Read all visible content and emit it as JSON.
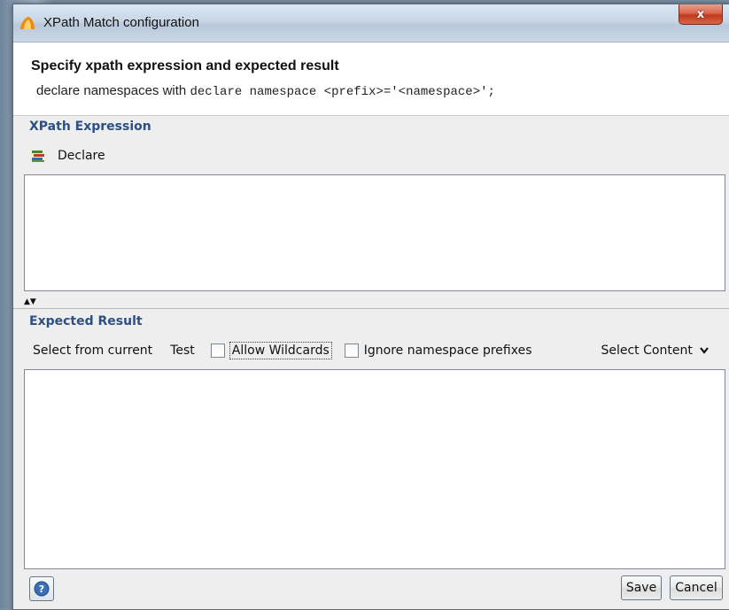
{
  "window": {
    "title": "XPath Match configuration",
    "close_label": "x"
  },
  "header": {
    "title": "Specify xpath expression and expected result",
    "desc_prefix": "declare namespaces with ",
    "desc_code": "declare namespace <prefix>='<namespace>';"
  },
  "xpath": {
    "section_label": "XPath Expression",
    "declare_label": "Declare",
    "value": ""
  },
  "splitter": {
    "up": "▲",
    "down": "▼"
  },
  "expected": {
    "section_label": "Expected Result",
    "select_from_current": "Select from current",
    "test": "Test",
    "allow_wildcards": "Allow Wildcards",
    "ignore_ns": "Ignore namespace prefixes",
    "select_content": "Select Content",
    "value": ""
  },
  "footer": {
    "help_label": "?",
    "save_label": "Save",
    "cancel_label": "Cancel"
  }
}
